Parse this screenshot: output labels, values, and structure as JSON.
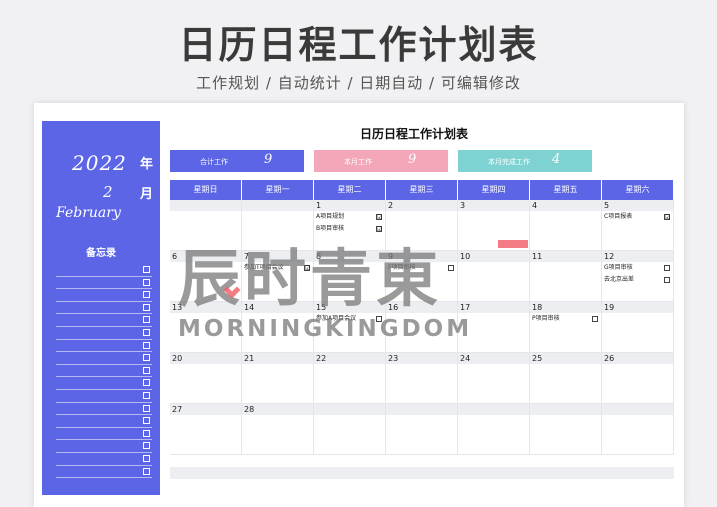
{
  "header": {
    "title": "日历日程工作计划表",
    "subtitle": "工作规划 / 自动统计 / 日期自动 / 可编辑修改"
  },
  "sidebar": {
    "year": "2022",
    "year_label": "年",
    "month": "2",
    "month_label": "月",
    "month_en": "February",
    "memo_title": "备忘录",
    "memo_count": 17
  },
  "calendar_title": "日历日程工作计划表",
  "stats": [
    {
      "label": "合计工作",
      "value": "9"
    },
    {
      "label": "本月工作",
      "value": "9"
    },
    {
      "label": "本月完成工作",
      "value": "4"
    }
  ],
  "weekdays": [
    "星期日",
    "星期一",
    "星期二",
    "星期三",
    "星期四",
    "星期五",
    "星期六"
  ],
  "weeks": [
    [
      {
        "num": "",
        "events": []
      },
      {
        "num": "",
        "events": []
      },
      {
        "num": "1",
        "events": [
          {
            "text": "A项目规划",
            "check": "☑"
          },
          {
            "text": "B项目审核",
            "check": "☑"
          }
        ]
      },
      {
        "num": "2",
        "events": []
      },
      {
        "num": "3",
        "events": []
      },
      {
        "num": "4",
        "events": []
      },
      {
        "num": "5",
        "events": [
          {
            "text": "C项目报表",
            "check": "☑"
          }
        ]
      }
    ],
    [
      {
        "num": "6",
        "events": []
      },
      {
        "num": "7",
        "events": [
          {
            "text": "参加T项目会议",
            "check": "☑"
          }
        ]
      },
      {
        "num": "8",
        "events": []
      },
      {
        "num": "9",
        "events": [
          {
            "text": "F项目审核",
            "check": ""
          }
        ]
      },
      {
        "num": "10",
        "events": []
      },
      {
        "num": "11",
        "events": []
      },
      {
        "num": "12",
        "events": [
          {
            "text": "G项目审核",
            "check": ""
          },
          {
            "text": "去北京出差",
            "check": ""
          }
        ]
      }
    ],
    [
      {
        "num": "13",
        "events": []
      },
      {
        "num": "14",
        "events": []
      },
      {
        "num": "15",
        "events": [
          {
            "text": "参加A项目会议",
            "check": ""
          }
        ]
      },
      {
        "num": "16",
        "events": []
      },
      {
        "num": "17",
        "events": []
      },
      {
        "num": "18",
        "events": [
          {
            "text": "P项目审核",
            "check": ""
          }
        ]
      },
      {
        "num": "19",
        "events": []
      }
    ],
    [
      {
        "num": "20",
        "events": []
      },
      {
        "num": "21",
        "events": []
      },
      {
        "num": "22",
        "events": []
      },
      {
        "num": "23",
        "events": []
      },
      {
        "num": "24",
        "events": []
      },
      {
        "num": "25",
        "events": []
      },
      {
        "num": "26",
        "events": []
      }
    ],
    [
      {
        "num": "27",
        "events": []
      },
      {
        "num": "28",
        "events": []
      },
      {
        "num": "",
        "events": []
      },
      {
        "num": "",
        "events": []
      },
      {
        "num": "",
        "events": []
      },
      {
        "num": "",
        "events": []
      },
      {
        "num": "",
        "events": []
      }
    ]
  ],
  "watermark": {
    "cn": "辰时青東",
    "en": "MORNINGKINGDOM"
  },
  "colors": {
    "accent": "#5b65e6",
    "pink": "#f4a7b9",
    "teal": "#7ed3d2"
  }
}
